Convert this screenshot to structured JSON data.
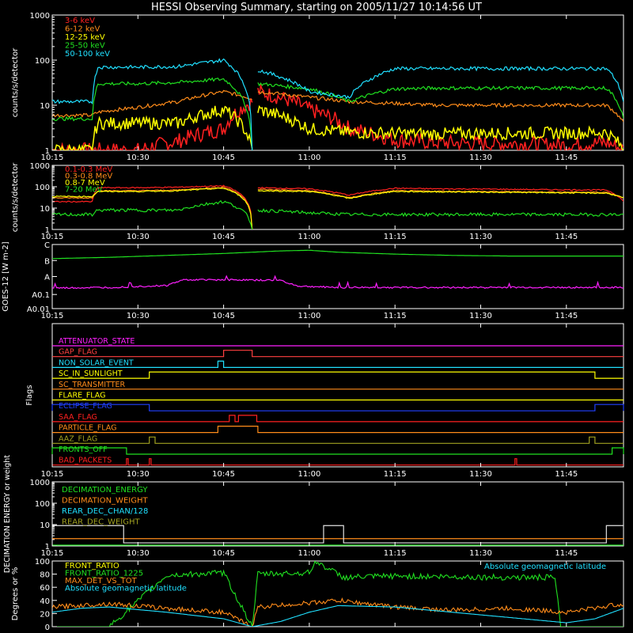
{
  "title": "HESSI Observing Summary, starting on 2005/11/27 10:14:56 UT",
  "time_ticks": [
    "10:15",
    "10:30",
    "10:45",
    "11:00",
    "11:15",
    "11:30",
    "11:45"
  ],
  "chart_data": [
    {
      "id": "hxr",
      "type": "line",
      "ylabel": "counts/s/detector",
      "yscale": "log",
      "ylim": [
        1,
        1000
      ],
      "yticks": [
        "1",
        "10",
        "100",
        "1000"
      ],
      "x_unit": "minutes after 10:15 UT",
      "series": [
        {
          "name": "3-6 keV",
          "color": "#ff2020",
          "x": [
            0,
            7,
            8,
            15,
            22,
            30,
            35,
            36,
            45,
            52,
            60,
            67,
            75,
            82,
            90,
            97,
            100
          ],
          "y": [
            1,
            1,
            1,
            1,
            1.6,
            3,
            12,
            20,
            8,
            3,
            1.7,
            1.5,
            1.4,
            1.4,
            1.3,
            1.5,
            1
          ]
        },
        {
          "name": "6-12 keV",
          "color": "#ff8c1a",
          "x": [
            0,
            7,
            8,
            15,
            22,
            30,
            35,
            36,
            45,
            52,
            60,
            67,
            75,
            82,
            90,
            97,
            100
          ],
          "y": [
            6,
            6,
            7,
            9,
            12,
            20,
            14,
            20,
            15,
            12,
            11,
            10,
            10,
            10,
            10,
            10,
            4
          ]
        },
        {
          "name": "12-25 keV",
          "color": "#ffff00",
          "x": [
            0,
            7,
            8,
            15,
            22,
            30,
            35,
            36,
            45,
            52,
            60,
            67,
            75,
            82,
            90,
            97,
            100
          ],
          "y": [
            1,
            1,
            4,
            4,
            4,
            8,
            1,
            8,
            3,
            2.5,
            2.4,
            2.3,
            2.4,
            2.4,
            2.4,
            2.5,
            1
          ]
        },
        {
          "name": "25-50 keV",
          "color": "#20e020",
          "x": [
            0,
            7,
            8,
            15,
            22,
            30,
            35,
            36,
            45,
            52,
            60,
            67,
            75,
            82,
            90,
            97,
            100
          ],
          "y": [
            5,
            5,
            30,
            30,
            32,
            38,
            1,
            30,
            23,
            12,
            23,
            24,
            24,
            24,
            24,
            24,
            5
          ]
        },
        {
          "name": "50-100 keV",
          "color": "#20e0ff",
          "x": [
            0,
            7,
            8,
            15,
            22,
            30,
            35,
            36,
            45,
            52,
            60,
            67,
            75,
            82,
            90,
            97,
            100
          ],
          "y": [
            12,
            12,
            70,
            70,
            72,
            100,
            1,
            60,
            20,
            15,
            65,
            65,
            65,
            65,
            65,
            65,
            12
          ]
        }
      ]
    },
    {
      "id": "gamma",
      "type": "line",
      "ylabel": "counts/s/detector",
      "yscale": "log",
      "ylim": [
        1,
        1000
      ],
      "yticks": [
        "1",
        "10",
        "100",
        "1000"
      ],
      "x_unit": "minutes after 10:15 UT",
      "series": [
        {
          "name": "0.1-0.3 MeV",
          "color": "#ff2020",
          "x": [
            0,
            7,
            8,
            15,
            22,
            30,
            35,
            36,
            45,
            52,
            60,
            67,
            75,
            82,
            90,
            97,
            100
          ],
          "y": [
            20,
            20,
            90,
            90,
            95,
            110,
            1,
            90,
            80,
            40,
            85,
            80,
            78,
            75,
            72,
            70,
            20
          ]
        },
        {
          "name": "0.3-0.8 MeV",
          "color": "#ff8c1a",
          "x": [
            0,
            7,
            8,
            15,
            22,
            30,
            35,
            36,
            45,
            52,
            60,
            67,
            75,
            82,
            90,
            97,
            100
          ],
          "y": [
            30,
            30,
            65,
            65,
            70,
            95,
            1,
            75,
            65,
            30,
            65,
            62,
            60,
            58,
            56,
            55,
            30
          ]
        },
        {
          "name": "0.8-7 MeV",
          "color": "#ffff00",
          "x": [
            0,
            7,
            8,
            15,
            22,
            30,
            35,
            36,
            45,
            52,
            60,
            67,
            75,
            82,
            90,
            97,
            100
          ],
          "y": [
            35,
            35,
            60,
            60,
            65,
            85,
            1,
            65,
            60,
            28,
            60,
            58,
            56,
            54,
            52,
            50,
            30
          ]
        },
        {
          "name": "7-20 MeV",
          "color": "#20e020",
          "x": [
            0,
            7,
            8,
            15,
            22,
            30,
            35,
            36,
            45,
            52,
            60,
            67,
            75,
            82,
            90,
            97,
            100
          ],
          "y": [
            5,
            5,
            8,
            8,
            8,
            20,
            1,
            8,
            6,
            5,
            5,
            5,
            5,
            5,
            5,
            5,
            5
          ]
        }
      ]
    },
    {
      "id": "goes",
      "type": "line",
      "ylabel": "GOES-12 [W m-2]",
      "yticks": [
        "A0.01",
        "A0.1",
        "A",
        "B",
        "C"
      ],
      "x_unit": "minutes after 10:15 UT",
      "series": [
        {
          "color": "#20e020",
          "x": [
            0,
            10,
            20,
            30,
            40,
            45,
            50,
            60,
            70,
            80,
            90,
            100
          ],
          "y": [
            0.78,
            0.8,
            0.83,
            0.86,
            0.9,
            0.91,
            0.88,
            0.85,
            0.83,
            0.82,
            0.82,
            0.82
          ]
        },
        {
          "color": "#ff20ff",
          "x": [
            0,
            10,
            20,
            23,
            30,
            40,
            43,
            50,
            60,
            70,
            80,
            90,
            100
          ],
          "y": [
            0.32,
            0.33,
            0.36,
            0.45,
            0.45,
            0.44,
            0.35,
            0.33,
            0.33,
            0.33,
            0.33,
            0.33,
            0.33
          ]
        }
      ]
    },
    {
      "id": "flags",
      "type": "line",
      "ylabel": "Flags",
      "x_unit": "minutes after 10:15 UT",
      "series": [
        {
          "name": "ATTENUATOR_STATE",
          "color": "#ff20ff",
          "steps": []
        },
        {
          "name": "GAP_FLAG",
          "color": "#ff4040",
          "steps": [
            [
              30,
              35
            ]
          ]
        },
        {
          "name": "NON_SOLAR_EVENT",
          "color": "#20e0ff",
          "steps": [
            [
              29,
              30
            ]
          ]
        },
        {
          "name": "SC_IN_SUNLIGHT",
          "color": "#ffff00",
          "steps": [
            [
              17,
              95
            ]
          ]
        },
        {
          "name": "SC_TRANSMITTER",
          "color": "#ff8c1a",
          "steps": []
        },
        {
          "name": "FLARE_FLAG",
          "color": "#ffff00",
          "steps": []
        },
        {
          "name": "ECLIPSE_FLAG",
          "color": "#2040ff",
          "steps": [
            [
              0,
              17
            ],
            [
              95,
              100
            ]
          ]
        },
        {
          "name": "SAA_FLAG",
          "color": "#ff2020",
          "steps": [
            [
              31,
              32
            ],
            [
              32.6,
              35.8
            ]
          ]
        },
        {
          "name": "PARTICLE_FLAG",
          "color": "#ff8c1a",
          "steps": [
            [
              29,
              36
            ]
          ]
        },
        {
          "name": "AAZ_FLAG",
          "color": "#a0a020",
          "steps": [
            [
              17,
              18
            ],
            [
              94,
              95
            ]
          ]
        },
        {
          "name": "FRONTS_OFF",
          "color": "#20e020",
          "steps": [
            [
              0,
              13
            ],
            [
              98,
              100
            ]
          ]
        },
        {
          "name": "BAD_PACKETS",
          "color": "#ff2020",
          "steps": [
            [
              13,
              13.3
            ],
            [
              17,
              17.3
            ],
            [
              81,
              81.3
            ]
          ]
        }
      ]
    },
    {
      "id": "decimation",
      "type": "line",
      "ylabel": "DECIMATION ENERGY or weight",
      "yscale": "log",
      "ylim": [
        1,
        1000
      ],
      "yticks": [
        "1",
        "10",
        "100",
        "1000"
      ],
      "x_unit": "minutes after 10:15 UT",
      "series": [
        {
          "name": "DECIMATION_ENERGY",
          "color": "#20e020",
          "x": [
            0,
            100
          ],
          "y": [
            1,
            1
          ]
        },
        {
          "name": "DECIMATION_WEIGHT",
          "color": "#ff8c1a",
          "x": [
            0,
            100
          ],
          "y": [
            2,
            2
          ]
        },
        {
          "name": "REAR_DEC_CHAN/128",
          "color": "#20e0ff",
          "x": [
            0,
            100
          ],
          "y": [
            1,
            1
          ]
        },
        {
          "name": "REAR_DEC_WEIGHT",
          "color": "#a0a020",
          "steps": [
            [
              0,
              12.5
            ],
            [
              47.5,
              51
            ],
            [
              97,
              100
            ]
          ]
        }
      ]
    },
    {
      "id": "ratio",
      "type": "line",
      "ylabel": "Degrees or %",
      "ylim": [
        0,
        100
      ],
      "yticks": [
        "0",
        "20",
        "40",
        "60",
        "80",
        "100"
      ],
      "x_unit": "minutes after 10:15 UT",
      "annotation": "Absolute geomagnetic latitude",
      "series": [
        {
          "name": "FRONT_RATIO",
          "color": "#ffff00"
        },
        {
          "name": "FRONT_RATIO_1225",
          "color": "#20e020",
          "x": [
            0,
            10,
            20,
            30,
            35,
            36,
            45,
            46,
            51,
            60,
            70,
            80,
            88,
            89,
            100
          ],
          "y": [
            0,
            0,
            78,
            82,
            0,
            80,
            82,
            100,
            75,
            77,
            76,
            75,
            75,
            0,
            0
          ]
        },
        {
          "name": "MAX_DET_VS_TOT",
          "color": "#ff8c1a",
          "x": [
            0,
            10,
            20,
            30,
            35,
            36,
            45,
            50,
            60,
            70,
            80,
            90,
            100
          ],
          "y": [
            30,
            35,
            28,
            22,
            0,
            30,
            36,
            40,
            30,
            25,
            28,
            22,
            35
          ]
        },
        {
          "name": "Absolute geomagnetic latitude",
          "color": "#20e0ff",
          "x": [
            0,
            5,
            10,
            20,
            30,
            35,
            40,
            45,
            50,
            60,
            70,
            80,
            90,
            95,
            100
          ],
          "y": [
            22,
            28,
            30,
            22,
            12,
            0,
            8,
            22,
            32,
            30,
            22,
            14,
            6,
            12,
            28
          ]
        }
      ]
    }
  ]
}
